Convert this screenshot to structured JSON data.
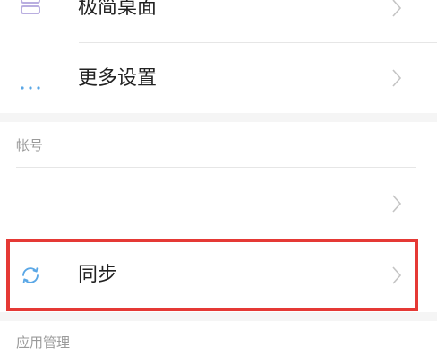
{
  "settings": {
    "items": [
      {
        "label": "极简桌面",
        "icon": "minimal-desktop-icon"
      },
      {
        "label": "更多设置",
        "icon": "more-dots-icon"
      }
    ]
  },
  "sections": {
    "account": {
      "title": "帐号",
      "item_label": "",
      "sync_label": "同步",
      "sync_icon": "sync-icon"
    },
    "apps": {
      "title": "应用管理"
    }
  },
  "colors": {
    "highlight": "#e53935",
    "chevron": "#c4c4c4",
    "icon_purple": "#b9aee0",
    "icon_blue": "#5aa7e6",
    "section_bg": "#f5f5f5"
  }
}
